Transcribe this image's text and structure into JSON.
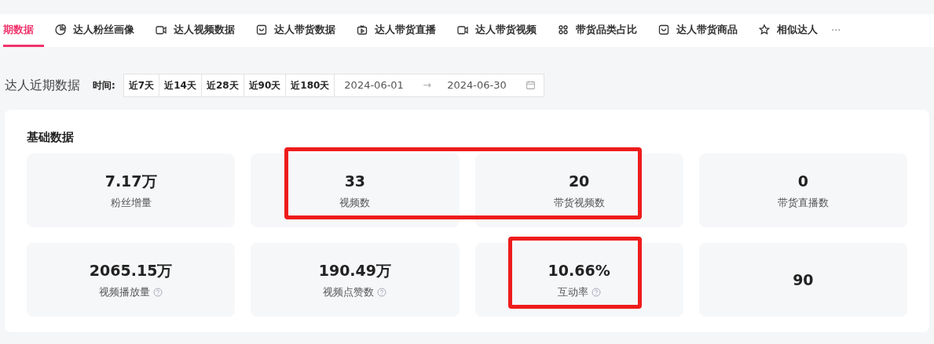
{
  "tabs": [
    {
      "label": "期数据",
      "selected": true
    },
    {
      "label": "达人粉丝画像",
      "kind": "pie",
      "selected": false
    },
    {
      "label": "达人视频数据",
      "kind": "video",
      "selected": false
    },
    {
      "label": "达人带货数据",
      "kind": "bag",
      "selected": false
    },
    {
      "label": "达人带货直播",
      "kind": "live",
      "selected": false
    },
    {
      "label": "达人带货视频",
      "kind": "video",
      "selected": false
    },
    {
      "label": "带货品类占比",
      "kind": "grid",
      "selected": false
    },
    {
      "label": "达人带货商品",
      "kind": "bag",
      "selected": false
    },
    {
      "label": "相似达人",
      "kind": "star",
      "selected": false
    }
  ],
  "more": "···",
  "section_title": "达人近期数据",
  "time_label": "时间:",
  "ranges": [
    {
      "label": "近7天",
      "selected": false
    },
    {
      "label": "近14天",
      "selected": false
    },
    {
      "label": "近28天",
      "selected": false
    },
    {
      "label": "近90天",
      "selected": false
    },
    {
      "label": "近180天",
      "selected": false
    }
  ],
  "date_start": "2024-06-01",
  "date_end": "2024-06-30",
  "date_sep": "→",
  "panel_title": "基础数据",
  "rows": [
    [
      {
        "value": "7.17万",
        "label": "粉丝增量",
        "help": false,
        "framed": false
      },
      {
        "value": "33",
        "label": "视频数",
        "help": false,
        "framed": true
      },
      {
        "value": "20",
        "label": "带货视频数",
        "help": false,
        "framed": true
      },
      {
        "value": "0",
        "label": "带货直播数",
        "help": false,
        "framed": false
      }
    ],
    [
      {
        "value": "2065.15万",
        "label": "视频播放量",
        "help": true,
        "framed": false
      },
      {
        "value": "190.49万",
        "label": "视频点赞数",
        "help": true,
        "framed": false
      },
      {
        "value": "10.66%",
        "label": "互动率",
        "help": true,
        "framed": true
      },
      {
        "value": "90",
        "help": false,
        "framed": false
      }
    ]
  ]
}
